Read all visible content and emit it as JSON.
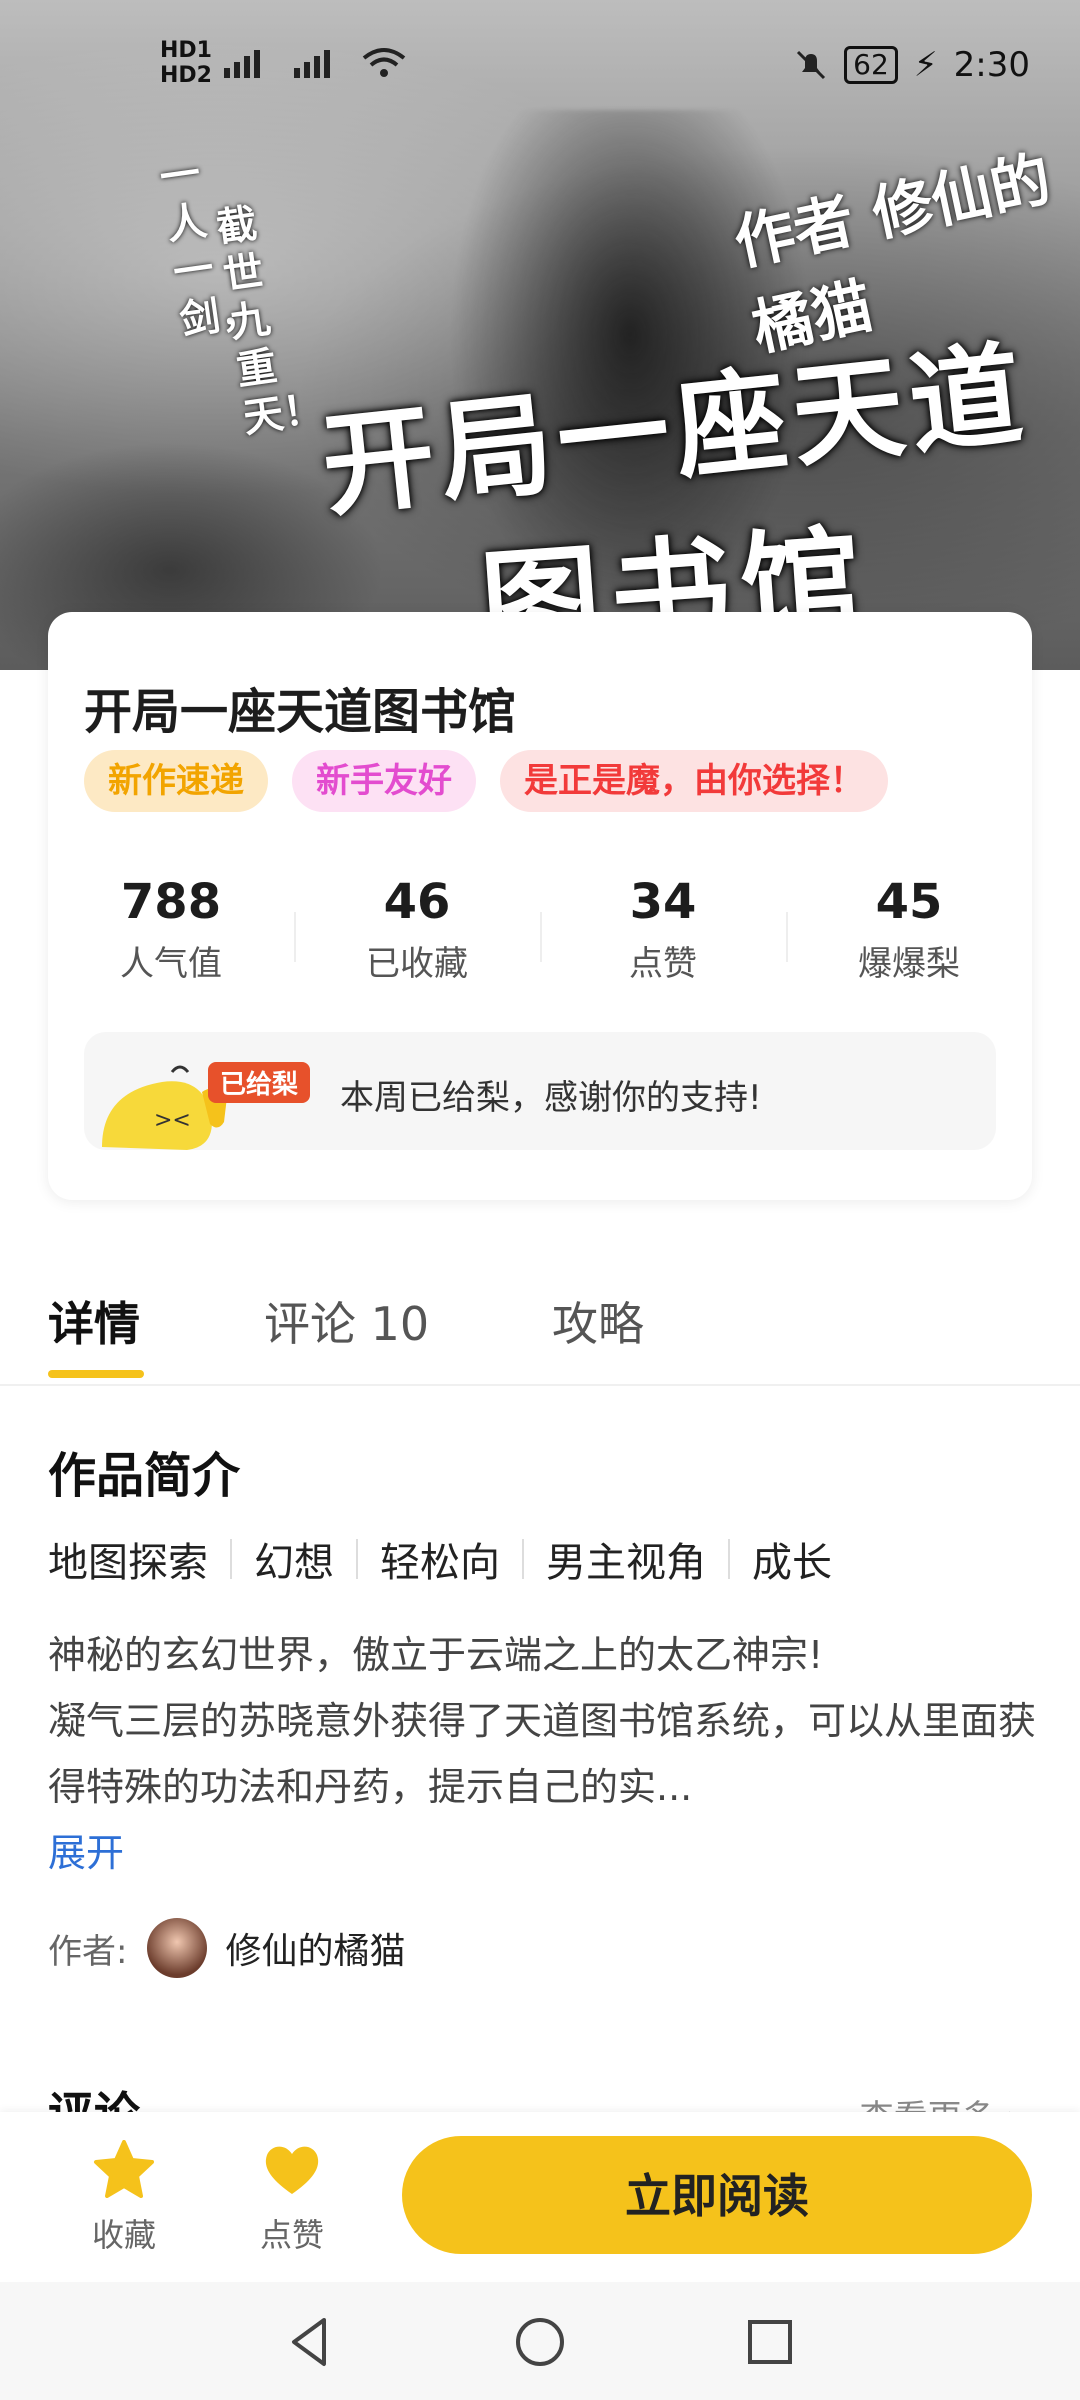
{
  "status_bar": {
    "left": "HD1 46 HD2 46 ⏃",
    "battery": "62",
    "time": "2:30"
  },
  "banner": {
    "title_line1": "开局一座天道",
    "title_line2": "图书馆",
    "author_text": "作者 修仙的橘猫",
    "vertical_text1": "一人一剑，",
    "vertical_text2": "截世九重天！"
  },
  "book": {
    "title": "开局一座天道图书馆",
    "tags": [
      "新作速递",
      "新手友好",
      "是正是魔，由你选择！"
    ],
    "stats": [
      {
        "value": "788",
        "label": "人气值"
      },
      {
        "value": "46",
        "label": "已收藏"
      },
      {
        "value": "34",
        "label": "点赞"
      },
      {
        "value": "45",
        "label": "爆爆梨"
      }
    ],
    "given_badge": "已给梨",
    "support_text": "本周已给梨，感谢你的支持!"
  },
  "tabs": [
    {
      "label": "详情"
    },
    {
      "label": "评论 10"
    },
    {
      "label": "攻略"
    }
  ],
  "details": {
    "section_title": "作品简介",
    "keywords": [
      "地图探索",
      "幻想",
      "轻松向",
      "男主视角",
      "成长"
    ],
    "summary": "神秘的玄幻世界，傲立于云端之上的太乙神宗!\n凝气三层的苏晓意外获得了天道图书馆系统，可以从里面获得特殊的功法和丹药，提示自己的实...",
    "expand": "展开",
    "author_label": "作者:",
    "author_name": "修仙的橘猫"
  },
  "comments": {
    "title": "评论",
    "more": "查看更多 ›"
  },
  "bottom_bar": {
    "favorite": "收藏",
    "like": "点赞",
    "read": "立即阅读"
  },
  "colors": {
    "accent": "#f5c21b",
    "link": "#2d6fd6"
  }
}
